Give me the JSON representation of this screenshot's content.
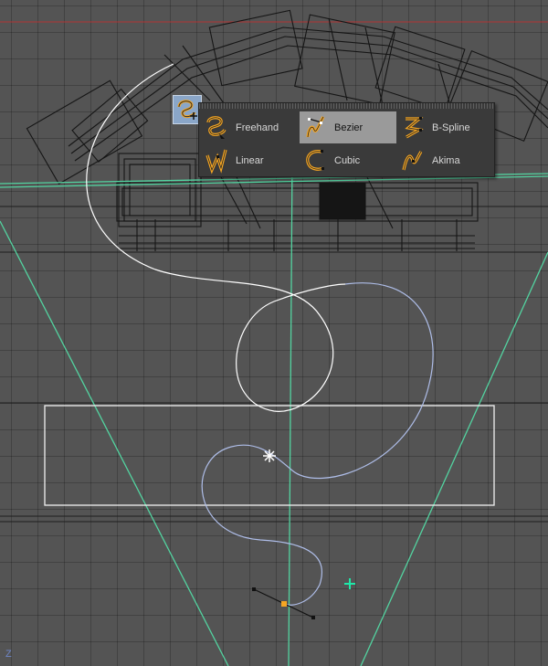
{
  "viewport": {
    "axis_indicator": "Z",
    "colors": {
      "background": "#545454",
      "grid": "#474747",
      "wireframe": "#151515",
      "camera_frustum": "#53d3a0",
      "safe_frame": "#f0f0f0",
      "spline_active": "#aebde8",
      "spline_inactive": "#ffffff",
      "spline_point": "#f5a623",
      "crosshair": "#1ee8a8"
    }
  },
  "spline_tool": {
    "icon": "spline-pen-icon",
    "menu": {
      "items": [
        {
          "label": "Freehand",
          "icon": "freehand-spline-icon",
          "selected": false
        },
        {
          "label": "Bezier",
          "icon": "bezier-spline-icon",
          "selected": true
        },
        {
          "label": "B-Spline",
          "icon": "b-spline-icon",
          "selected": false
        },
        {
          "label": "Linear",
          "icon": "linear-spline-icon",
          "selected": false
        },
        {
          "label": "Cubic",
          "icon": "cubic-spline-icon",
          "selected": false
        },
        {
          "label": "Akima",
          "icon": "akima-spline-icon",
          "selected": false
        }
      ]
    }
  }
}
